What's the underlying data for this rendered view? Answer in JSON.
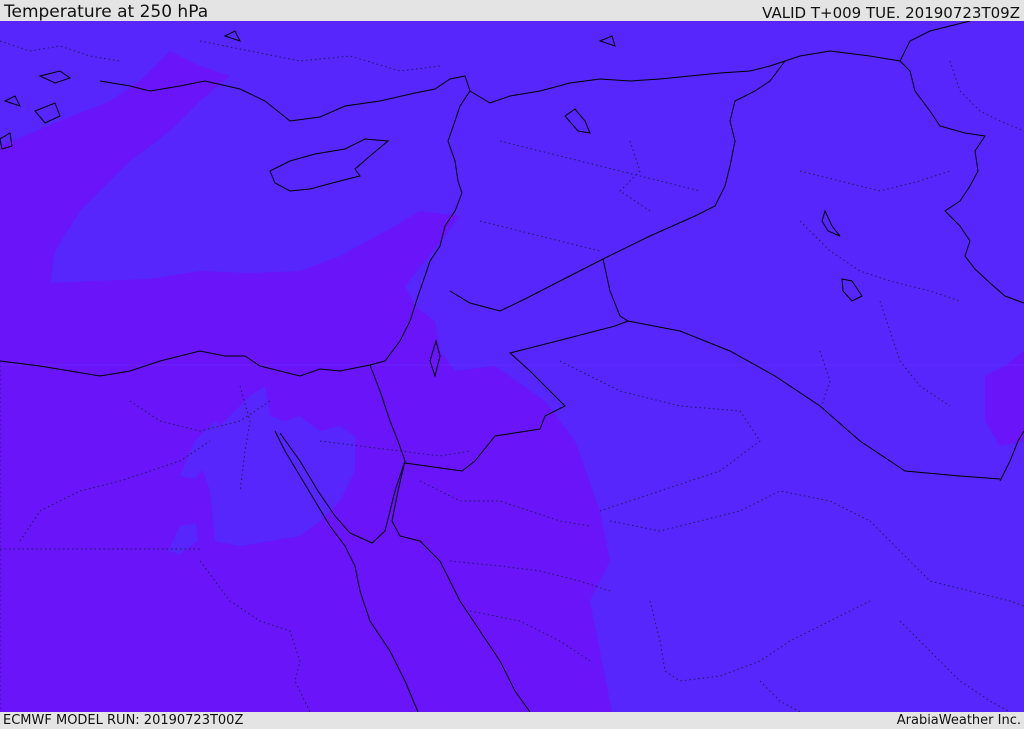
{
  "header": {
    "title": "Temperature at 250 hPa",
    "valid_time": "VALID T+009 TUE. 20190723T09Z"
  },
  "footer": {
    "model_run": "ECMWF MODEL RUN: 20190723T00Z",
    "credit": "ArabiaWeather Inc."
  },
  "map": {
    "colors": {
      "warm_band": "#6a14fa",
      "cool_band": "#5626fd",
      "coastline": "#000000",
      "internal_border": "#1a1a55"
    }
  }
}
